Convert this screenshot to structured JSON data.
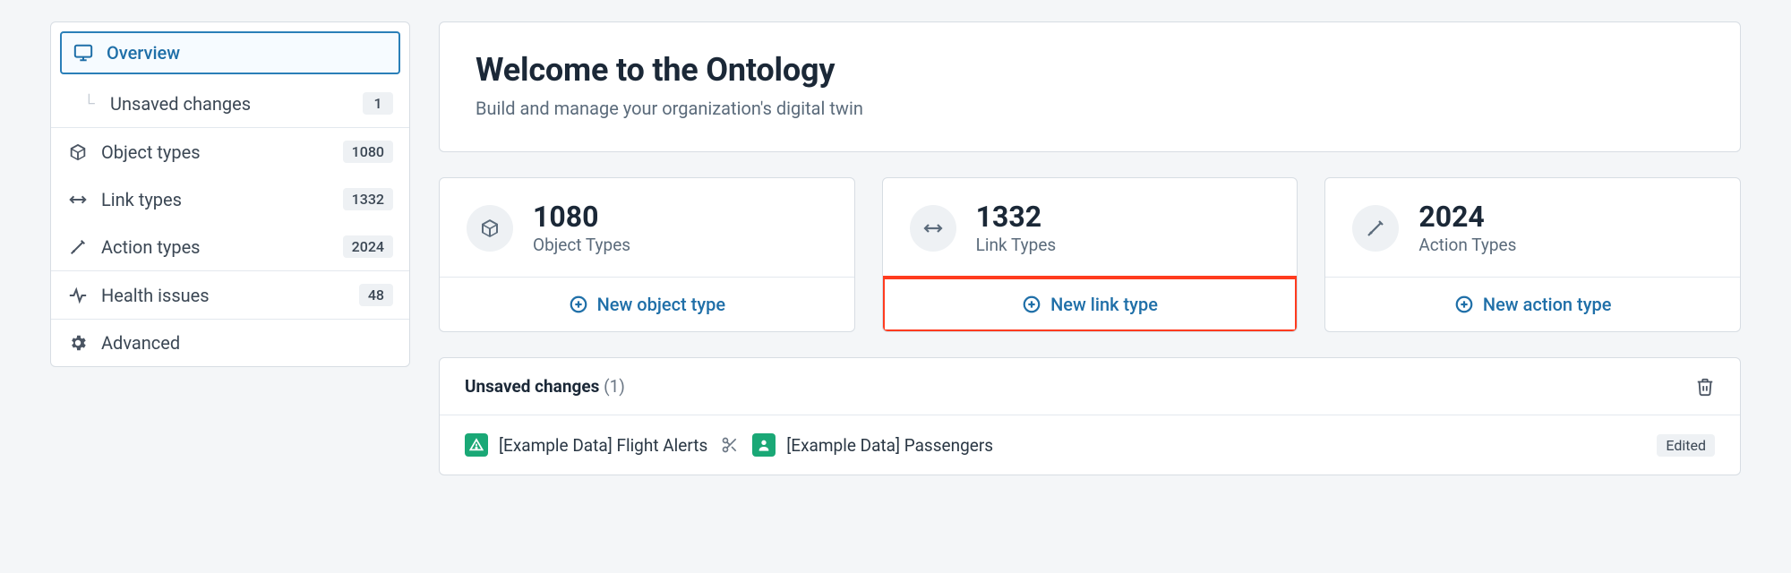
{
  "sidebar": {
    "overview": {
      "label": "Overview"
    },
    "unsaved": {
      "label": "Unsaved changes",
      "count": "1"
    },
    "object_types": {
      "label": "Object types",
      "count": "1080"
    },
    "link_types": {
      "label": "Link types",
      "count": "1332"
    },
    "action_types": {
      "label": "Action types",
      "count": "2024"
    },
    "health": {
      "label": "Health issues",
      "count": "48"
    },
    "advanced": {
      "label": "Advanced"
    }
  },
  "header": {
    "title": "Welcome to the Ontology",
    "subtitle": "Build and manage your organization's digital twin"
  },
  "stats": {
    "object": {
      "value": "1080",
      "label": "Object Types",
      "action": "New object type"
    },
    "link": {
      "value": "1332",
      "label": "Link Types",
      "action": "New link type"
    },
    "action": {
      "value": "2024",
      "label": "Action Types",
      "action": "New action type"
    }
  },
  "changes": {
    "title": "Unsaved changes",
    "count": "(1)",
    "row": {
      "left": "[Example Data] Flight Alerts",
      "right": "[Example Data] Passengers",
      "status": "Edited"
    }
  }
}
